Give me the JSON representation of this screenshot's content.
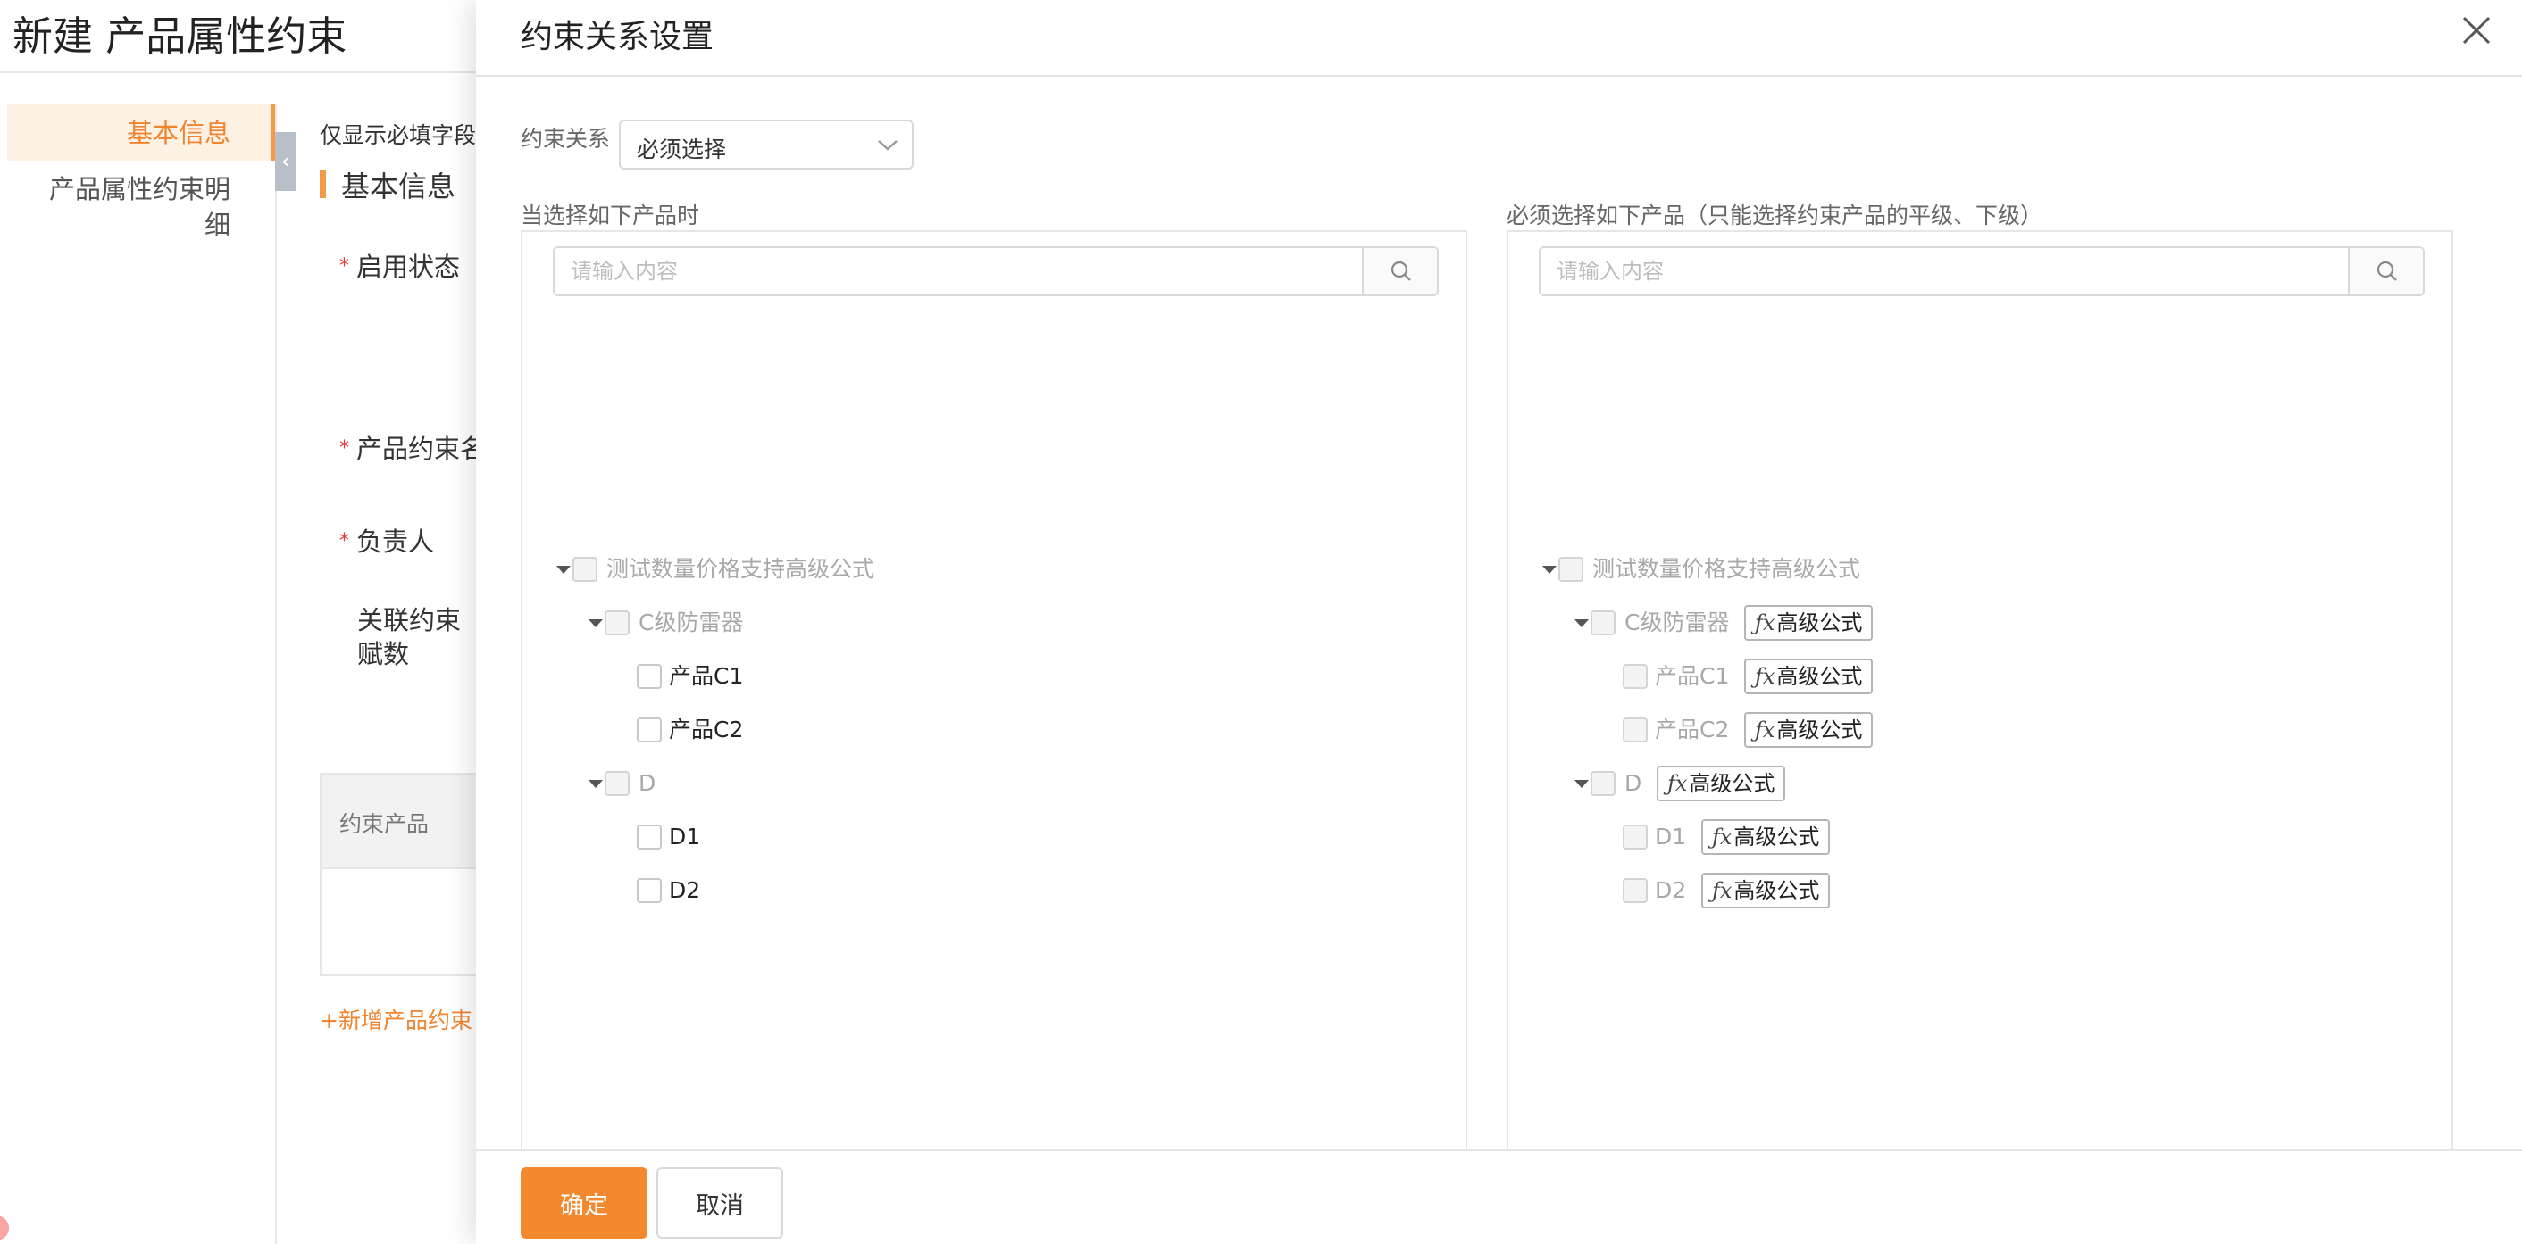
{
  "background_page": {
    "title": "新建 产品属性约束",
    "nav": [
      "基本信息",
      "产品属性约束明细"
    ],
    "collapse_icon": "chevron-left",
    "required_only_label": "仅显示必填字段",
    "section_title": "基本信息",
    "fields": {
      "status": "启用状态",
      "constraint_name": "产品约束名",
      "owner": "负责人",
      "linked_count": "关联约束赋数"
    },
    "table_header": "约束产品",
    "add_link": "+新增产品约束"
  },
  "drawer": {
    "title": "约束关系设置",
    "close_icon": "close",
    "relation_label": "约束关系",
    "relation_value": "必须选择",
    "left_panel": {
      "caption": "当选择如下产品时",
      "search_placeholder": "请输入内容",
      "tree": [
        {
          "label": "测试数量价格支持高级公式"
        },
        {
          "label": "C级防雷器"
        },
        {
          "label": "产品C1"
        },
        {
          "label": "产品C2"
        },
        {
          "label": "D"
        },
        {
          "label": "D1"
        },
        {
          "label": "D2"
        }
      ]
    },
    "right_panel": {
      "caption": "必须选择如下产品（只能选择约束产品的平级、下级）",
      "search_placeholder": "请输入内容",
      "formula_label": "高级公式",
      "fx_symbol": "ƒx",
      "tree": [
        {
          "label": "测试数量价格支持高级公式"
        },
        {
          "label": "C级防雷器"
        },
        {
          "label": "产品C1"
        },
        {
          "label": "产品C2"
        },
        {
          "label": "D"
        },
        {
          "label": "D1"
        },
        {
          "label": "D2"
        }
      ]
    },
    "confirm_label": "确定",
    "cancel_label": "取消"
  },
  "colors": {
    "accent": "#f2892f",
    "required": "#e4393c",
    "disabled_text": "#a8a8a8"
  }
}
